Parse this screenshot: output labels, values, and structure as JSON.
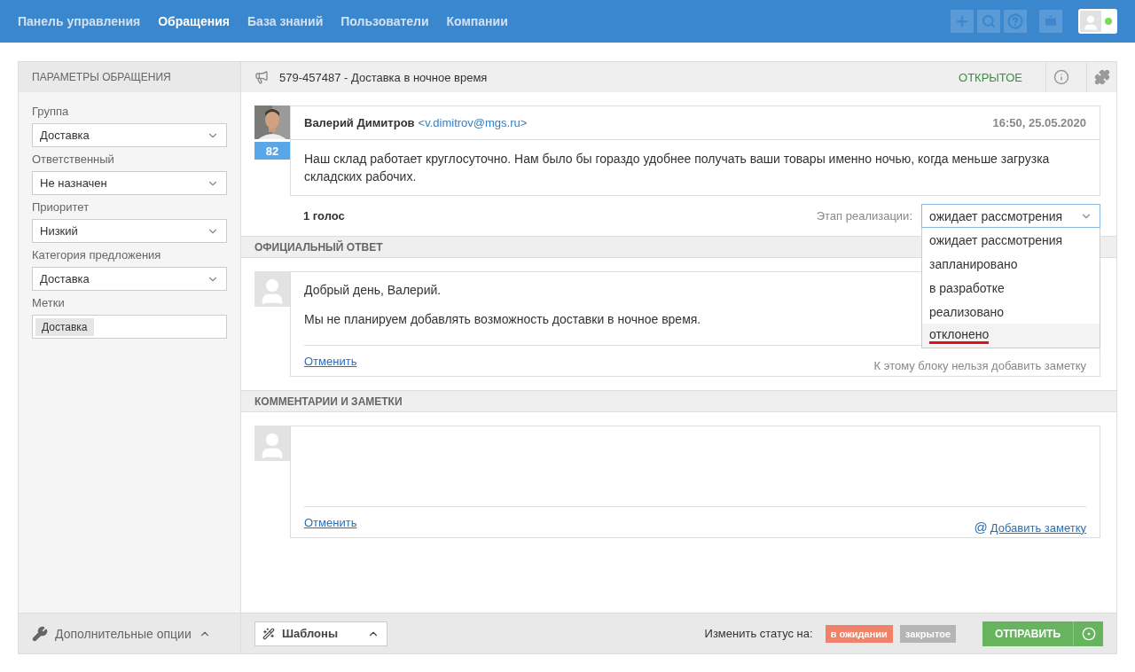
{
  "nav": {
    "items": [
      {
        "label": "Панель управления",
        "selected": false
      },
      {
        "label": "Обращения",
        "selected": true
      },
      {
        "label": "База знаний",
        "selected": false
      },
      {
        "label": "Пользователи",
        "selected": false
      },
      {
        "label": "Компании",
        "selected": false
      }
    ],
    "online": true
  },
  "sidebar": {
    "title": "ПАРАМЕТРЫ ОБРАЩЕНИЯ",
    "fields": [
      {
        "kind": "select",
        "label": "Группа",
        "value": "Доставка"
      },
      {
        "kind": "select",
        "label": "Ответственный",
        "value": "Не назначен"
      },
      {
        "kind": "select",
        "label": "Приоритет",
        "value": "Низкий"
      },
      {
        "kind": "select",
        "label": "Категория предложения",
        "value": "Доставка"
      },
      {
        "kind": "tags",
        "label": "Метки",
        "tags": [
          "Доставка"
        ]
      }
    ],
    "footer": "Дополнительные опции"
  },
  "ticket": {
    "title": "579-457487 - Доставка в ночное время",
    "status": "ОТКРЫТОЕ"
  },
  "message": {
    "author": "Валерий Димитров",
    "email": "<v.dimitrov@mgs.ru>",
    "time": "16:50, 25.05.2020",
    "score": "82",
    "text": "Наш склад работает круглосуточно. Нам было бы гораздо удобнее получать ваши товары именно ночью, когда меньше загрузка складских рабочих.",
    "votes": "1 голос",
    "stage_label": "Этап реализации:",
    "stage_value": "ожидает рассмотрения",
    "stage_open": true,
    "stage_options": [
      {
        "label": "ожидает рассмотрения",
        "hovered": false
      },
      {
        "label": "запланировано",
        "hovered": false
      },
      {
        "label": "в разработке",
        "hovered": false
      },
      {
        "label": "реализовано",
        "hovered": false
      },
      {
        "label": "отклонено",
        "hovered": true
      }
    ]
  },
  "official": {
    "title": "ОФИЦИАЛЬНЫЙ ОТВЕТ",
    "paragraphs": [
      "Добрый день, Валерий.",
      "Мы не планируем добавлять возможность доставки в ночное время."
    ],
    "cancel": "Отменить",
    "note": "К этому блоку нельзя добавить заметку"
  },
  "comments": {
    "title": "КОММЕНТАРИИ И ЗАМЕТКИ",
    "cancel": "Отменить",
    "at": "@",
    "add": "Добавить заметку"
  },
  "footer": {
    "templates": "Шаблоны",
    "status_label": "Изменить статус на:",
    "statuses": [
      {
        "label": "в ожидании",
        "color": "#f0826a"
      },
      {
        "label": "закрытое",
        "color": "#b5b5b5"
      }
    ],
    "send": "ОТПРАВИТЬ"
  }
}
